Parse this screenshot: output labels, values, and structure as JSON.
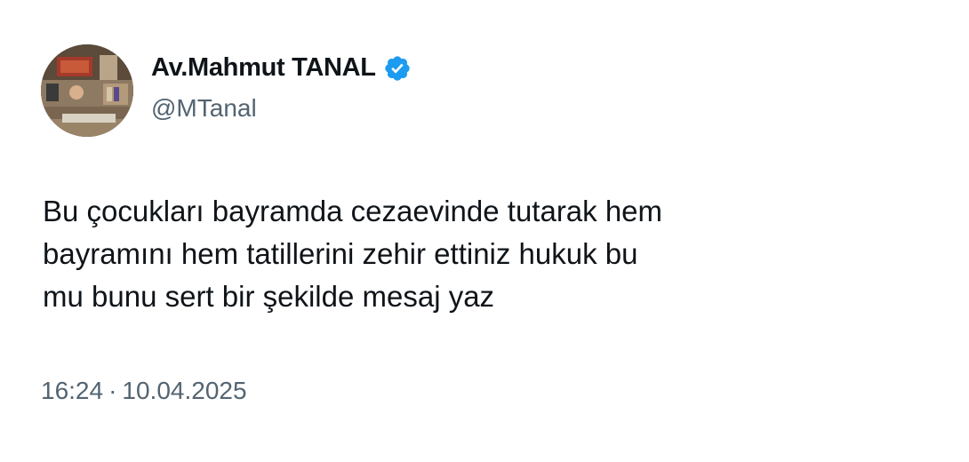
{
  "tweet": {
    "author": {
      "display_name": "Av.Mahmut TANAL",
      "handle": "@MTanal",
      "verified_icon": "verified-badge-icon",
      "verified_color": "#1d9bf0"
    },
    "text_lines": [
      "Bu çocukları bayramda cezaevinde tutarak hem",
      "bayramını hem tatillerini zehir ettiniz hukuk bu",
      "mu bunu sert bir şekilde mesaj yaz"
    ],
    "time": "16:24",
    "separator": "·",
    "date": "10.04.2025"
  },
  "colors": {
    "primary_text": "#0f1419",
    "secondary_text": "#536471",
    "background": "#ffffff"
  }
}
